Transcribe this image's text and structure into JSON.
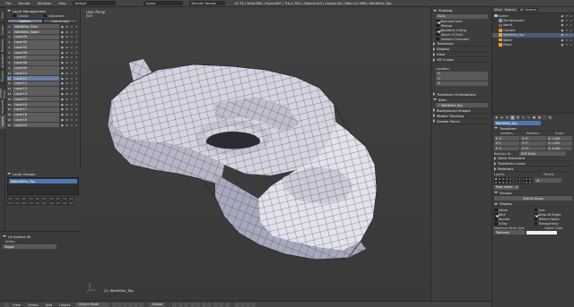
{
  "topbar": {
    "menus": [
      "File",
      "Render",
      "Window",
      "Help"
    ],
    "layout_value": "Default",
    "scene_value": "Scene",
    "engine_value": "Blender Render",
    "stats": "v2.76 | Verts:880 | Faces:867 | Tris:1,762 | Objects:0/3 | Lamps:0/0 | Mem:14.56M | WetWilhe_Top"
  },
  "left_tabs": [
    "Tools",
    "Create",
    "Relations",
    "Animation",
    "Physics",
    "Grease Pencil",
    "MeasureIt",
    "Layers"
  ],
  "layer_panel": {
    "title": "Layer Management",
    "options": [
      {
        "label": "Classic",
        "checked": false
      },
      {
        "label": "Indicators",
        "checked": false
      }
    ],
    "tab_options": "Options",
    "tab_hide": "Hide Empty",
    "layers": [
      {
        "num": "1",
        "name": "WetWilhe_Floor",
        "selected": false
      },
      {
        "num": "2",
        "name": "WetWilhe_Water",
        "selected": false
      },
      {
        "num": "3",
        "name": "Layer03",
        "selected": false
      },
      {
        "num": "4",
        "name": "Layer04",
        "selected": false
      },
      {
        "num": "5",
        "name": "Layer05",
        "selected": false
      },
      {
        "num": "6",
        "name": "Layer06",
        "selected": false
      },
      {
        "num": "7",
        "name": "Layer07",
        "selected": false
      },
      {
        "num": "8",
        "name": "Layer08",
        "selected": false
      },
      {
        "num": "9",
        "name": "Layer09",
        "selected": false
      },
      {
        "num": "10",
        "name": "Layer10",
        "selected": false
      },
      {
        "num": "11",
        "name": "Layer11",
        "selected": true
      },
      {
        "num": "12",
        "name": "Layer12",
        "selected": false
      },
      {
        "num": "13",
        "name": "Layer13",
        "selected": false
      },
      {
        "num": "14",
        "name": "Layer14",
        "selected": false
      },
      {
        "num": "15",
        "name": "Layer15",
        "selected": false
      },
      {
        "num": "16",
        "name": "Layer16",
        "selected": false
      },
      {
        "num": "17",
        "name": "Layer17",
        "selected": false
      },
      {
        "num": "18",
        "name": "Layer18",
        "selected": false
      },
      {
        "num": "19",
        "name": "Layer19",
        "selected": false
      },
      {
        "num": "20",
        "name": "Layer20",
        "selected": false
      }
    ]
  },
  "layer_groups": {
    "title": "Layer Groups",
    "item": "WaterWilhe_Top"
  },
  "operator_panel": {
    "title": "(Un)select All",
    "action_label": "Action",
    "action_value": "Toggle"
  },
  "viewport": {
    "view_name": "User Persp",
    "sub_label": "Edit",
    "object_label": "(1) WetWilhe_Top"
  },
  "bottombar": {
    "menus": [
      "View",
      "Select",
      "Add",
      "Object"
    ],
    "mode": "Object Mode",
    "shading": "Solid",
    "pivot": "Global"
  },
  "npanel": {
    "shading_title": "Shading",
    "shading_value": "GLSL",
    "shading_opts": [
      {
        "label": "Textured Solid",
        "checked": true
      },
      {
        "label": "Matcap",
        "checked": false
      },
      {
        "label": "Backface Culling",
        "checked": true
      },
      {
        "label": "Depth Of Field",
        "checked": false
      },
      {
        "label": "Ambient Occlusion",
        "checked": false
      }
    ],
    "collapsed": [
      "Transform",
      "Display",
      "View",
      "3D Cursor"
    ],
    "location_label": "Location:",
    "cursor": [
      "X:",
      "Y:",
      "Z:"
    ],
    "orient": "Transform Orientations",
    "item_title": "Item",
    "item_value": "WetWilhe_Top",
    "collapsed2": [
      "Background Images",
      "Motion Tracking",
      "Grease Pencil"
    ]
  },
  "outliner": {
    "tabs": [
      "View",
      "Search",
      "All Scenes"
    ],
    "rows": [
      {
        "name": "Scene",
        "indent": 0,
        "color": "#bbbbbb",
        "selected": false
      },
      {
        "name": "RenderLayers",
        "indent": 1,
        "color": "#7a9bc4",
        "selected": false
      },
      {
        "name": "World",
        "indent": 1,
        "color": "#c84848",
        "selected": false
      },
      {
        "name": "Camera",
        "indent": 1,
        "color": "#d8a040",
        "selected": false
      },
      {
        "name": "WetWilhe_Top",
        "indent": 1,
        "color": "#f0a030",
        "selected": true
      },
      {
        "name": "Water",
        "indent": 1,
        "color": "#f0a030",
        "selected": false
      },
      {
        "name": "Plane",
        "indent": 1,
        "color": "#f0a030",
        "selected": false
      }
    ]
  },
  "properties": {
    "object_field": "WetWilhe_Top",
    "transform_title": "Transform",
    "loc_label": "Location:",
    "rot_label": "Rotation:",
    "scale_label": "Scale:",
    "rows": [
      [
        "X: 0",
        "X: 0°",
        "X: 1.000"
      ],
      [
        "Y: 0",
        "Y: 0°",
        "Y: 1.000"
      ],
      [
        "Z: 0",
        "Z: 0°",
        "Z: 1.000"
      ]
    ],
    "rotation_mode_label": "Rotation M...",
    "rotation_mode_value": "XYZ Euler",
    "collapsed": [
      "Delta Transform",
      "Transform Locks",
      "Relations"
    ],
    "layers_label": "Layers:",
    "parent_label": "Parent:",
    "parent_value": "",
    "pass_index": "Pass Index:",
    "pass_index_value": "0",
    "groups_title": "Groups",
    "add_group": "Add to Group",
    "display_title": "Display",
    "display_opts": [
      {
        "label": "Name",
        "checked": false
      },
      {
        "label": "Axis",
        "checked": false
      },
      {
        "label": "Wire",
        "checked": true
      },
      {
        "label": "Draw All Edges",
        "checked": true
      },
      {
        "label": "Bounds",
        "checked": false
      },
      {
        "label": "Texture Space",
        "checked": false
      },
      {
        "label": "X-Ray",
        "checked": false
      },
      {
        "label": "Transparency",
        "checked": false
      }
    ],
    "max_draw_label": "Maximum Draw Type:",
    "max_draw_value": "Textured",
    "obj_color_label": "Object Color:"
  }
}
